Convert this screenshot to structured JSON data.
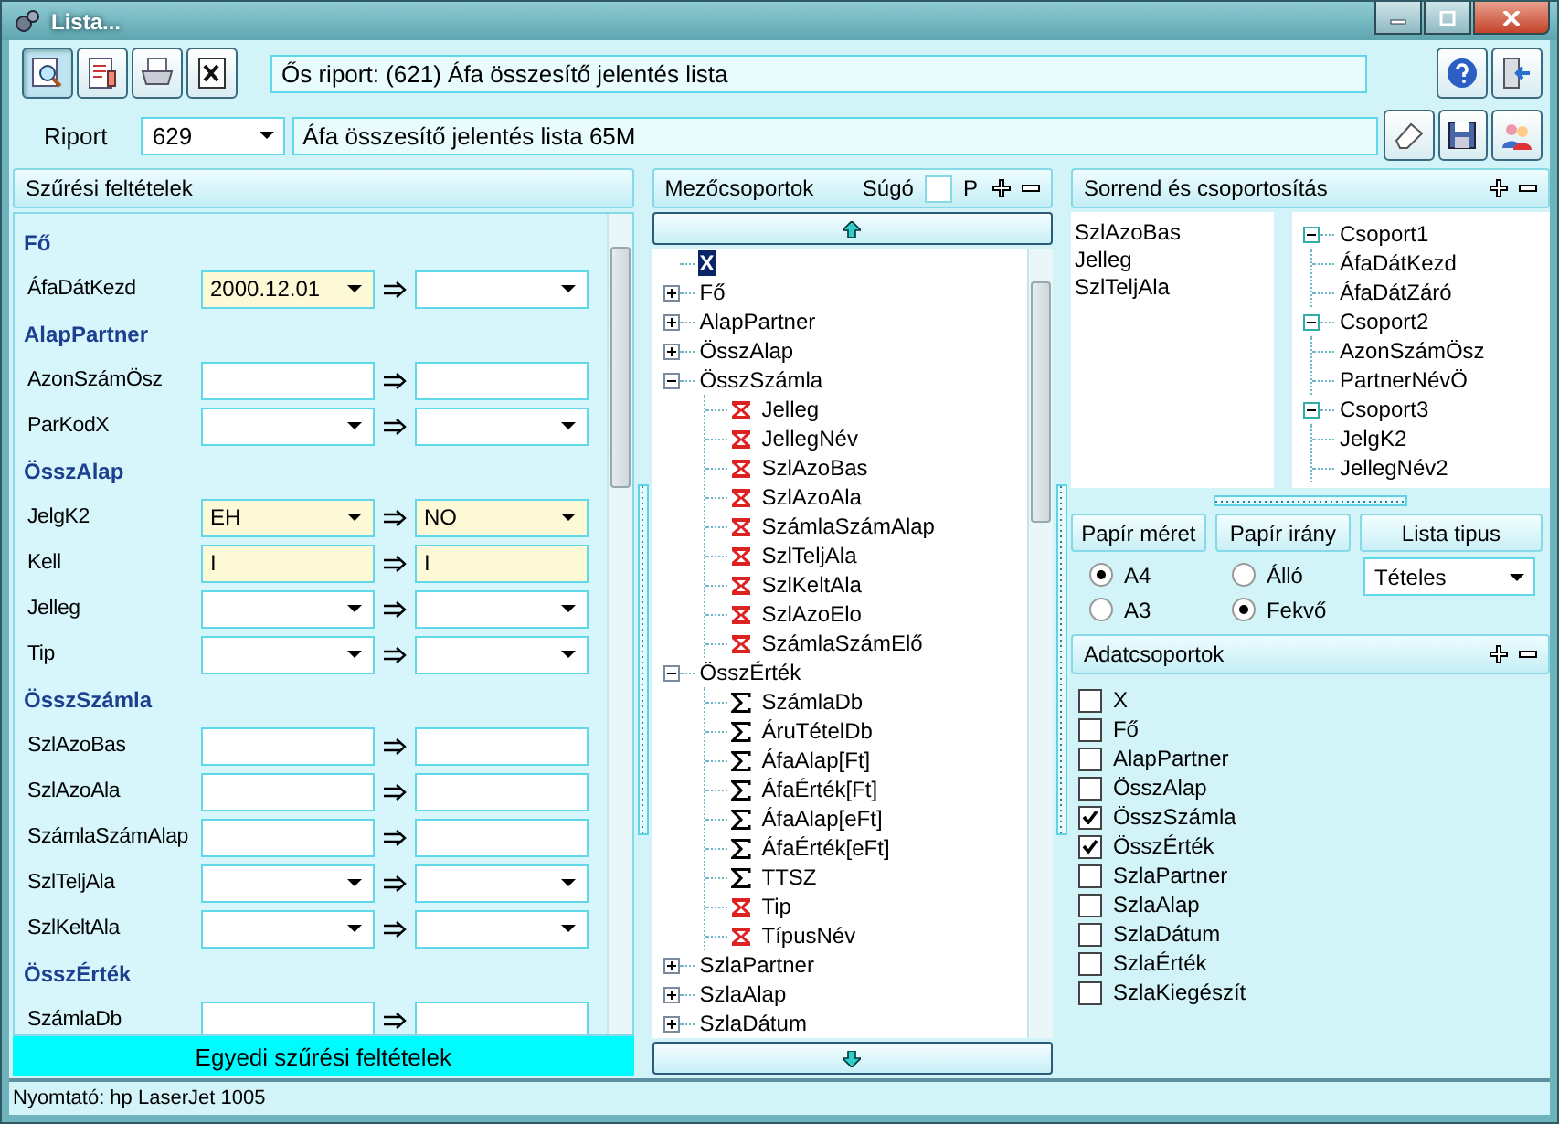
{
  "window": {
    "title": "Lista..."
  },
  "toolbar": {
    "parent_report": "Ős riport: (621)  Áfa összesítő jelentés lista"
  },
  "report": {
    "label": "Riport",
    "number": "629",
    "name": "Áfa összesítő jelentés lista 65M"
  },
  "filter_panel": {
    "title": "Szűrési feltételek",
    "footer_button": "Egyedi szűrési feltételek",
    "groups": [
      {
        "name": "Fő",
        "fields": [
          {
            "label": "ÁfaDátKezd",
            "kind": "combo",
            "from": "2000.12.01"
          }
        ]
      },
      {
        "name": "AlapPartner",
        "fields": [
          {
            "label": "AzonSzámÖsz",
            "kind": "text"
          },
          {
            "label": "ParKodX",
            "kind": "combo"
          }
        ]
      },
      {
        "name": "ÖsszAlap",
        "fields": [
          {
            "label": "JelgK2",
            "kind": "combo",
            "from": "EH",
            "to": "NO"
          },
          {
            "label": "Kell",
            "kind": "text",
            "from": "I",
            "to": "I"
          },
          {
            "label": "Jelleg",
            "kind": "combo"
          },
          {
            "label": "Tip",
            "kind": "combo"
          }
        ]
      },
      {
        "name": "ÖsszSzámla",
        "fields": [
          {
            "label": "SzlAzoBas",
            "kind": "text"
          },
          {
            "label": "SzlAzoAla",
            "kind": "text"
          },
          {
            "label": "SzámlaSzámAlap",
            "kind": "text"
          },
          {
            "label": "SzlTeljAla",
            "kind": "combo"
          },
          {
            "label": "SzlKeltAla",
            "kind": "combo"
          }
        ]
      },
      {
        "name": "ÖsszÉrték",
        "fields": [
          {
            "label": "SzámlaDb",
            "kind": "text"
          }
        ]
      }
    ]
  },
  "field_groups": {
    "title": "Mezőcsoportok",
    "help_label": "Súgó",
    "help_checked": false,
    "p_label": "P",
    "tree": [
      {
        "label": "X",
        "kind": "root",
        "selected": true
      },
      {
        "label": "Fő",
        "kind": "group",
        "expanded": false,
        "selected": false
      },
      {
        "label": "AlapPartner",
        "kind": "group",
        "expanded": false,
        "selected": false
      },
      {
        "label": "ÖsszAlap",
        "kind": "group",
        "expanded": false,
        "selected": false
      },
      {
        "label": "ÖsszSzámla",
        "kind": "group",
        "expanded": true,
        "selected": false,
        "children": [
          {
            "label": "Jelleg",
            "kind": "dimension"
          },
          {
            "label": "JellegNév",
            "kind": "dimension"
          },
          {
            "label": "SzlAzoBas",
            "kind": "dimension"
          },
          {
            "label": "SzlAzoAla",
            "kind": "dimension"
          },
          {
            "label": "SzámlaSzámAlap",
            "kind": "dimension"
          },
          {
            "label": "SzlTeljAla",
            "kind": "dimension"
          },
          {
            "label": "SzlKeltAla",
            "kind": "dimension"
          },
          {
            "label": "SzlAzoElo",
            "kind": "dimension"
          },
          {
            "label": "SzámlaSzámElő",
            "kind": "dimension"
          }
        ]
      },
      {
        "label": "ÖsszÉrték",
        "kind": "group",
        "expanded": true,
        "selected": false,
        "children": [
          {
            "label": "SzámlaDb",
            "kind": "measure"
          },
          {
            "label": "ÁruTételDb",
            "kind": "measure"
          },
          {
            "label": "ÁfaAlap[Ft]",
            "kind": "measure"
          },
          {
            "label": "ÁfaÉrték[Ft]",
            "kind": "measure"
          },
          {
            "label": "ÁfaAlap[eFt]",
            "kind": "measure"
          },
          {
            "label": "ÁfaÉrték[eFt]",
            "kind": "measure"
          },
          {
            "label": "TTSZ",
            "kind": "measure"
          },
          {
            "label": "Tip",
            "kind": "dimension"
          },
          {
            "label": "TípusNév",
            "kind": "dimension"
          }
        ]
      },
      {
        "label": "SzlaPartner",
        "kind": "group",
        "expanded": false,
        "selected": false
      },
      {
        "label": "SzlaAlap",
        "kind": "group",
        "expanded": false,
        "selected": false
      },
      {
        "label": "SzlaDátum",
        "kind": "group",
        "expanded": false,
        "selected": false
      }
    ]
  },
  "order_panel": {
    "title": "Sorrend és csoportosítás",
    "sort_fields": [
      "SzlAzoBas",
      "Jelleg",
      "SzlTeljAla"
    ],
    "groups": [
      {
        "label": "Csoport1",
        "expanded": true,
        "children": [
          {
            "label": "ÁfaDátKezd"
          },
          {
            "label": "ÁfaDátZáró"
          }
        ]
      },
      {
        "label": "Csoport2",
        "expanded": true,
        "children": [
          {
            "label": "AzonSzámÖsz"
          },
          {
            "label": "PartnerNévÖ"
          }
        ]
      },
      {
        "label": "Csoport3",
        "expanded": true,
        "children": [
          {
            "label": "JelgK2"
          },
          {
            "label": "JellegNév2"
          }
        ]
      }
    ]
  },
  "paper": {
    "size_button": "Papír méret",
    "orientation_button": "Papír irány",
    "list_type_button": "Lista tipus",
    "sizes": [
      {
        "label": "A4",
        "selected": true
      },
      {
        "label": "A3",
        "selected": false
      }
    ],
    "orientations": [
      {
        "label": "Álló",
        "selected": false
      },
      {
        "label": "Fekvő",
        "selected": true
      }
    ],
    "list_type": "Tételes"
  },
  "data_groups": {
    "title": "Adatcsoportok",
    "items": [
      {
        "label": "X",
        "checked": false
      },
      {
        "label": "Fő",
        "checked": false
      },
      {
        "label": "AlapPartner",
        "checked": false
      },
      {
        "label": "ÖsszAlap",
        "checked": false
      },
      {
        "label": "ÖsszSzámla",
        "checked": true
      },
      {
        "label": "ÖsszÉrték",
        "checked": true
      },
      {
        "label": "SzlaPartner",
        "checked": false
      },
      {
        "label": "SzlaAlap",
        "checked": false
      },
      {
        "label": "SzlaDátum",
        "checked": false
      },
      {
        "label": "SzlaÉrték",
        "checked": false
      },
      {
        "label": "SzlaKiegészít",
        "checked": false
      }
    ]
  },
  "status_bar": {
    "printer": "Nyomtató: hp LaserJet 1005"
  }
}
